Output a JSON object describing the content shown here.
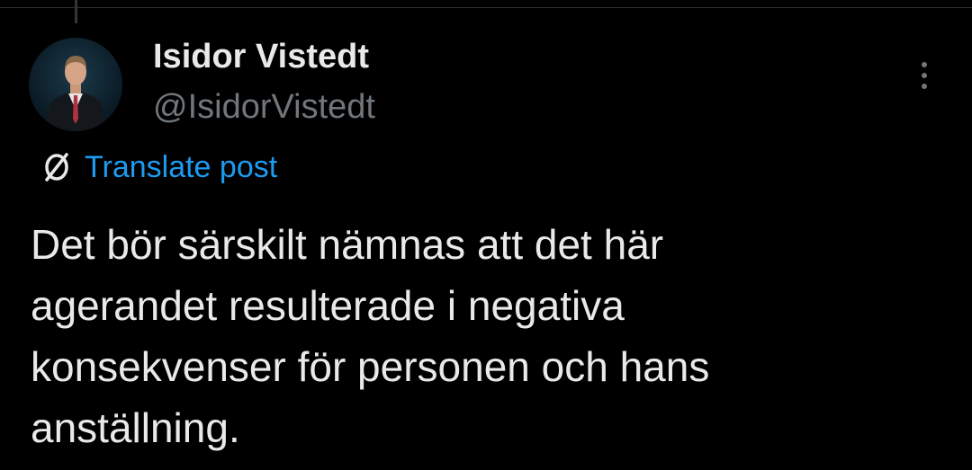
{
  "post": {
    "author": {
      "display_name": "Isidor Vistedt",
      "handle": "@IsidorVistedt",
      "avatar_icon": "profile-photo"
    },
    "more_icon": "more-vertical-icon",
    "translate": {
      "icon": "globe-icon",
      "label": "Translate post"
    },
    "text_lines": [
      "Det bör särskilt nämnas att det här",
      "agerandet resulterade i negativa",
      "konsekvenser för personen och hans",
      "anställning."
    ]
  },
  "colors": {
    "background": "#000000",
    "text_primary": "#e7e9ea",
    "text_secondary": "#71767b",
    "link": "#1d9bf0"
  }
}
